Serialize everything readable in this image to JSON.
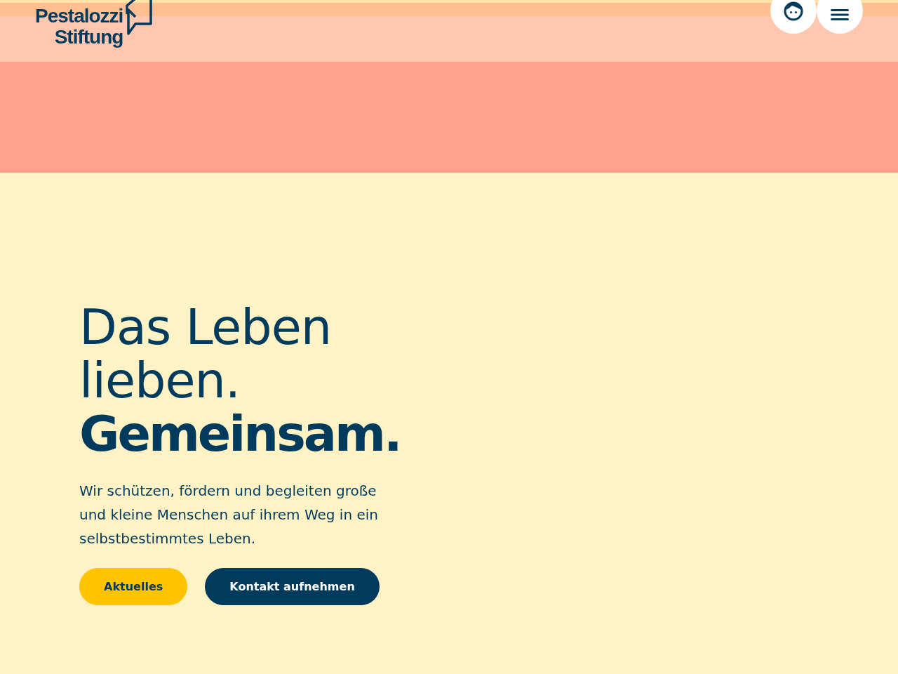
{
  "header": {
    "logo": [
      "Pestalozzi",
      "Stiftung"
    ],
    "buttons": [
      {
        "kind": "account"
      },
      {
        "kind": "menu"
      }
    ]
  },
  "hero": {
    "headline": "Das Leben lieben.",
    "headline_bold": "Gemeinsam.",
    "text": "Wir schützen, fördern und begleiten große und kleine Menschen auf ihrem Weg in ein selbstbestimmtes Leben.",
    "buttons": [
      {
        "label": "Aktuelles",
        "kind": "primary"
      },
      {
        "label": "Kontakt aufnehmen",
        "kind": "secondary"
      }
    ]
  }
}
